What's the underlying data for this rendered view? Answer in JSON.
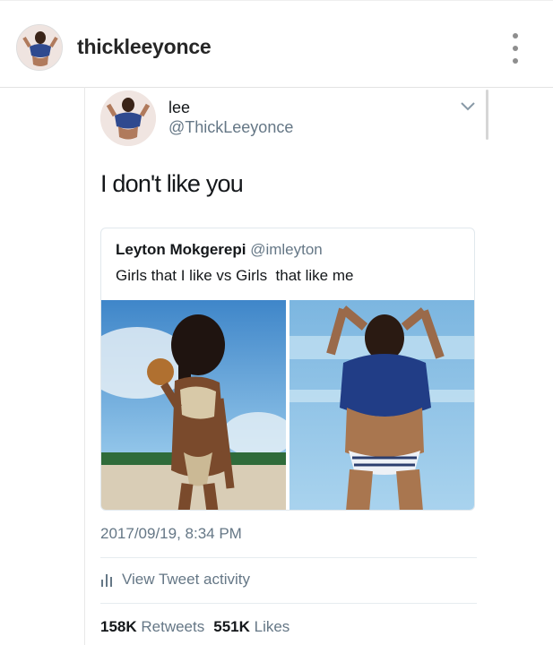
{
  "instagram": {
    "username": "thickleeyonce",
    "more_icon": "more-vertical-icon"
  },
  "tweet": {
    "name": "lee",
    "handle": "@ThickLeeyonce",
    "text": "I don't like you",
    "timestamp": "2017/09/19, 8:34 PM",
    "activity_label": "View Tweet activity",
    "retweets_count": "158K",
    "retweets_label": "Retweets",
    "likes_count": "551K",
    "likes_label": "Likes",
    "quoted": {
      "name": "Leyton Mokgerepi",
      "handle": "@imleyton",
      "text": "Girls that I like vs Girls  that like me"
    }
  },
  "colors": {
    "name_text": "#14171a",
    "secondary_text": "#657786",
    "border": "#e1e8ed"
  }
}
